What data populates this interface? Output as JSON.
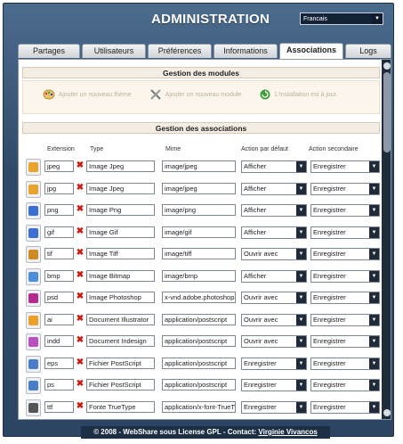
{
  "header": {
    "title": "ADMINISTRATION",
    "language": "Francais"
  },
  "tabs": [
    {
      "label": "Partages"
    },
    {
      "label": "Utilisateurs"
    },
    {
      "label": "Préférences"
    },
    {
      "label": "Informations"
    },
    {
      "label": "Associations"
    },
    {
      "label": "Logs"
    }
  ],
  "modules": {
    "heading": "Gestion des modules",
    "add_theme": "Ajouter un nouveau thème",
    "add_module": "Ajouter un nouveau module",
    "install_status": "L'installation est à jour."
  },
  "associations": {
    "heading": "Gestion des associations",
    "columns": [
      "Extension",
      "Type",
      "Mime",
      "Action par défaut",
      "Action secondaire"
    ],
    "rows": [
      {
        "ext": "jpeg",
        "type": "Image Jpeg",
        "mime": "image/jpeg",
        "default": "Afficher",
        "secondary": "Enregistrer",
        "icon": "image-file-icon",
        "color": "#e7a32e"
      },
      {
        "ext": "jpg",
        "type": "Image Jpeg",
        "mime": "image/jpeg",
        "default": "Afficher",
        "secondary": "Enregistrer",
        "icon": "image-file-icon",
        "color": "#e7a32e"
      },
      {
        "ext": "png",
        "type": "Image Png",
        "mime": "image/png",
        "default": "Afficher",
        "secondary": "Enregistrer",
        "icon": "image-file-icon",
        "color": "#3d6fd1"
      },
      {
        "ext": "gif",
        "type": "Image Gif",
        "mime": "image/gif",
        "default": "Afficher",
        "secondary": "Enregistrer",
        "icon": "image-file-icon",
        "color": "#3d6fd1"
      },
      {
        "ext": "tif",
        "type": "Image Tiff",
        "mime": "image/tiff",
        "default": "Ouvrir avec",
        "secondary": "Enregistrer",
        "icon": "image-file-icon",
        "color": "#d08a24"
      },
      {
        "ext": "bmp",
        "type": "Image Bitmap",
        "mime": "image/bmp",
        "default": "Afficher",
        "secondary": "Enregistrer",
        "icon": "image-file-icon",
        "color": "#4a8fd8"
      },
      {
        "ext": "psd",
        "type": "Image Photoshop",
        "mime": "x-vnd.adobe.photoshop",
        "default": "Ouvrir avec",
        "secondary": "Enregistrer",
        "icon": "photoshop-file-icon",
        "color": "#b52a8e"
      },
      {
        "ext": "ai",
        "type": "Document Illustrator",
        "mime": "application/postscript",
        "default": "Ouvrir avec",
        "secondary": "Enregistrer",
        "icon": "illustrator-file-icon",
        "color": "#e9a12a"
      },
      {
        "ext": "indd",
        "type": "Document Indesign",
        "mime": "application/postscript",
        "default": "Ouvrir avec",
        "secondary": "Enregistrer",
        "icon": "indesign-file-icon",
        "color": "#b74fbf"
      },
      {
        "ext": "eps",
        "type": "Fichier PostScript",
        "mime": "application/postscript",
        "default": "Enregistrer",
        "secondary": "Enregistrer",
        "icon": "postscript-file-icon",
        "color": "#4a7ec9"
      },
      {
        "ext": "ps",
        "type": "Fichier PostScript",
        "mime": "application/postscript",
        "default": "Enregistrer",
        "secondary": "Enregistrer",
        "icon": "postscript-file-icon",
        "color": "#4a7ec9"
      },
      {
        "ext": "ttf",
        "type": "Fonte TrueType",
        "mime": "application/x-font-TrueTy",
        "default": "Enregistrer",
        "secondary": "Enregistrer",
        "icon": "font-file-icon",
        "color": "#555555"
      }
    ]
  },
  "footer": {
    "text": "© 2008 - WebShare sous License GPL - Contact: ",
    "contact": "Virginie Vivancos"
  }
}
